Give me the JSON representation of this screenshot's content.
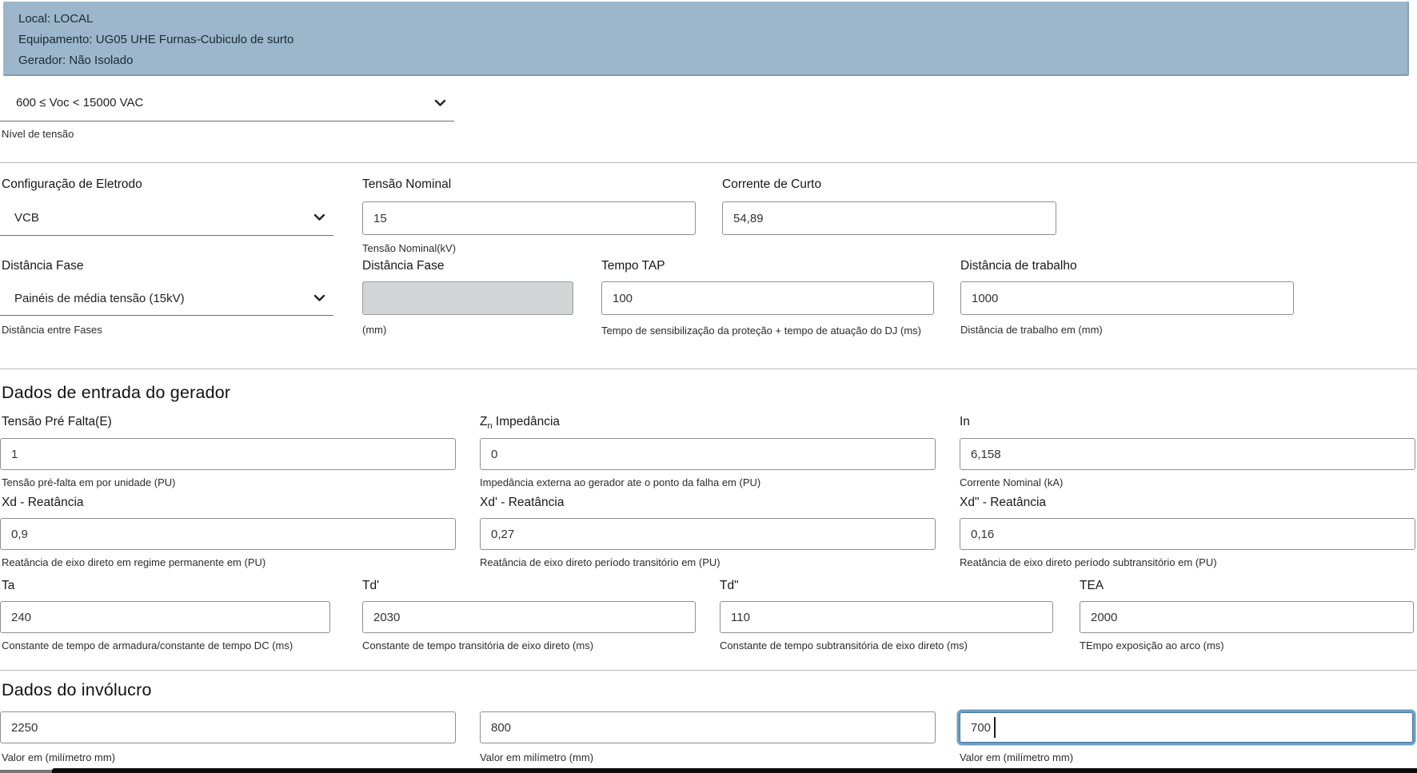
{
  "header": {
    "line1": "Local: LOCAL",
    "line2": "Equipamento: UG05 UHE Furnas-Cubiculo de surto",
    "line3": "Gerador: Não Isolado"
  },
  "voltage": {
    "selected": "600 ≤ Voc < 15000 VAC",
    "helper": "Nível de tensão"
  },
  "params": {
    "electrode": {
      "label": "Configuração de Eletrodo",
      "selected": "VCB"
    },
    "nominal_voltage": {
      "label": "Tensão Nominal",
      "value": "15",
      "helper": "Tensão Nominal(kV)"
    },
    "short_circuit": {
      "label": "Corrente de Curto",
      "value": "54,89"
    },
    "phase_distance_select": {
      "label": "Distância Fase",
      "selected": "Painéis de média tensão (15kV)",
      "helper": "Distância entre Fases"
    },
    "phase_distance_value": {
      "label": "Distância Fase",
      "value": "",
      "helper": "(mm)"
    },
    "tap_time": {
      "label": "Tempo TAP",
      "value": "100",
      "helper": "Tempo de sensibilização da proteção + tempo de atuação do DJ (ms)"
    },
    "working_distance": {
      "label": "Distância de trabalho",
      "value": "1000",
      "helper": "Distância de trabalho em (mm)"
    }
  },
  "generator": {
    "title": "Dados de entrada do gerador",
    "prefault_voltage": {
      "label": "Tensão Pré Falta(E)",
      "value": "1",
      "helper": "Tensão pré-falta em por unidade (PU)"
    },
    "zn_impedance": {
      "label_z": "Z",
      "label_sub": "n",
      "label_rest": "Impedância",
      "value": "0",
      "helper": "Impedância externa ao gerador ate o ponto da falha em (PU)"
    },
    "in_current": {
      "label": "In",
      "value": "6,158",
      "helper": "Corrente Nominal (kA)"
    },
    "xd": {
      "label": "Xd - Reatância",
      "value": "0,9",
      "helper": "Reatância de eixo direto em regime permanente em (PU)"
    },
    "xd_transient": {
      "label": "Xd' - Reatância",
      "value": "0,27",
      "helper": "Reatância de eixo direto período transitório em (PU)"
    },
    "xd_subtransient": {
      "label": "Xd\" - Reatância",
      "value": "0,16",
      "helper": "Reatância de eixo direto período subtransitório em (PU)"
    },
    "ta": {
      "label": "Ta",
      "value": "240",
      "helper": "Constante de tempo de armadura/constante de tempo DC (ms)"
    },
    "td_transient": {
      "label": "Td'",
      "value": "2030",
      "helper": "Constante de tempo transitória de eixo direto (ms)"
    },
    "td_subtransient": {
      "label": "Td\"",
      "value": "110",
      "helper": "Constante de tempo subtransitória de eixo direto (ms)"
    },
    "tea": {
      "label": "TEA",
      "value": "2000",
      "helper": "TEmpo exposição ao arco (ms)"
    }
  },
  "enclosure": {
    "title": "Dados do invólucro",
    "dim1": {
      "value": "2250",
      "helper": "Valor em (milímetro mm)"
    },
    "dim2": {
      "value": "800",
      "helper": "Valor em milímetro (mm)"
    },
    "dim3": {
      "value": "700",
      "helper": "Valor em (milímetro mm)"
    }
  },
  "colors": {
    "header_bg": "#9cb6cb",
    "focus_border": "#6c9cc2",
    "disabled_bg": "#d2d4d5"
  }
}
